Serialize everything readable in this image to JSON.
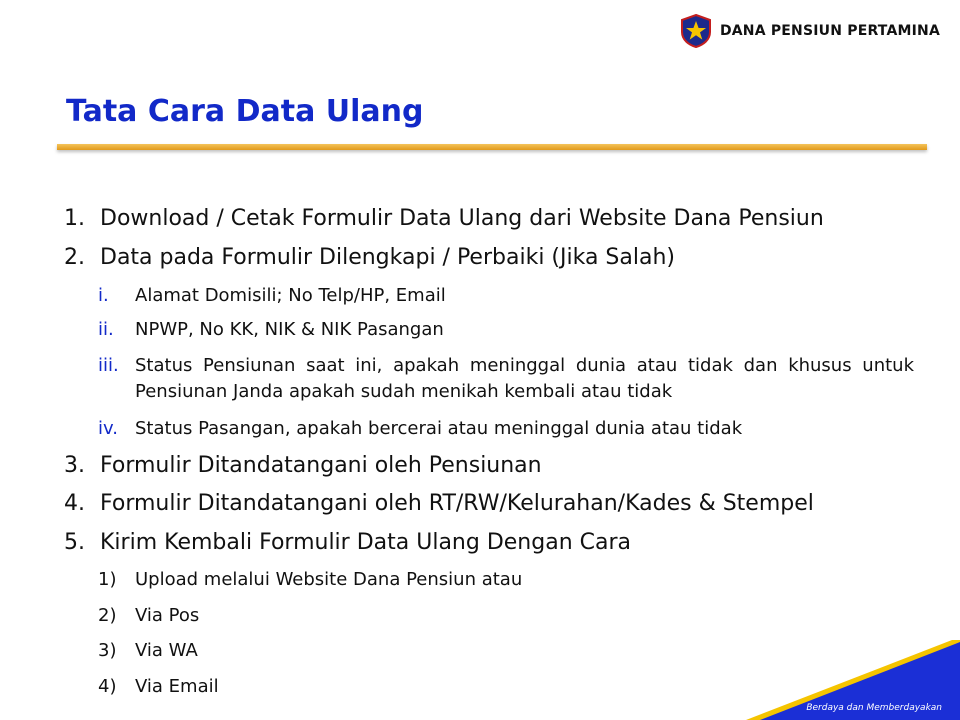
{
  "header": {
    "org_name": "DANA PENSIUN PERTAMINA",
    "logo_icon": "pertamina-star-shield-icon"
  },
  "title": "Tata Cara Data Ulang",
  "items": [
    {
      "num": "1.",
      "text": "Download / Cetak Formulir Data Ulang dari Website Dana Pensiun"
    },
    {
      "num": "2.",
      "text": "Data pada Formulir Dilengkapi / Perbaiki (Jika Salah)",
      "sub": [
        {
          "num": "i.",
          "text": "Alamat Domisili; No Telp/HP, Email"
        },
        {
          "num": "ii.",
          "text": "NPWP, No KK, NIK & NIK Pasangan"
        },
        {
          "num": "iii.",
          "text": "Status Pensiunan saat ini, apakah meninggal dunia atau tidak dan khusus untuk Pensiunan Janda apakah sudah menikah kembali atau tidak"
        },
        {
          "num": "iv.",
          "text": "Status Pasangan, apakah bercerai atau meninggal dunia atau tidak"
        }
      ]
    },
    {
      "num": "3.",
      "text": "Formulir Ditandatangani oleh Pensiunan"
    },
    {
      "num": "4.",
      "text": "Formulir Ditandatangani oleh RT/RW/Kelurahan/Kades & Stempel"
    },
    {
      "num": "5.",
      "text": "Kirim Kembali Formulir Data Ulang Dengan Cara",
      "sub": [
        {
          "num": "1)",
          "text": "Upload melalui Website Dana Pensiun atau"
        },
        {
          "num": "2)",
          "text": "Via Pos"
        },
        {
          "num": "3)",
          "text": "Via WA"
        },
        {
          "num": "4)",
          "text": "Via Email"
        }
      ]
    }
  ],
  "footer": {
    "tagline": "Berdaya dan Memberdayakan"
  },
  "colors": {
    "title_blue": "#1229c8",
    "rule_orange": "#e8a32a",
    "corner_blue": "#1b2fd6",
    "corner_yellow": "#f5c400"
  }
}
